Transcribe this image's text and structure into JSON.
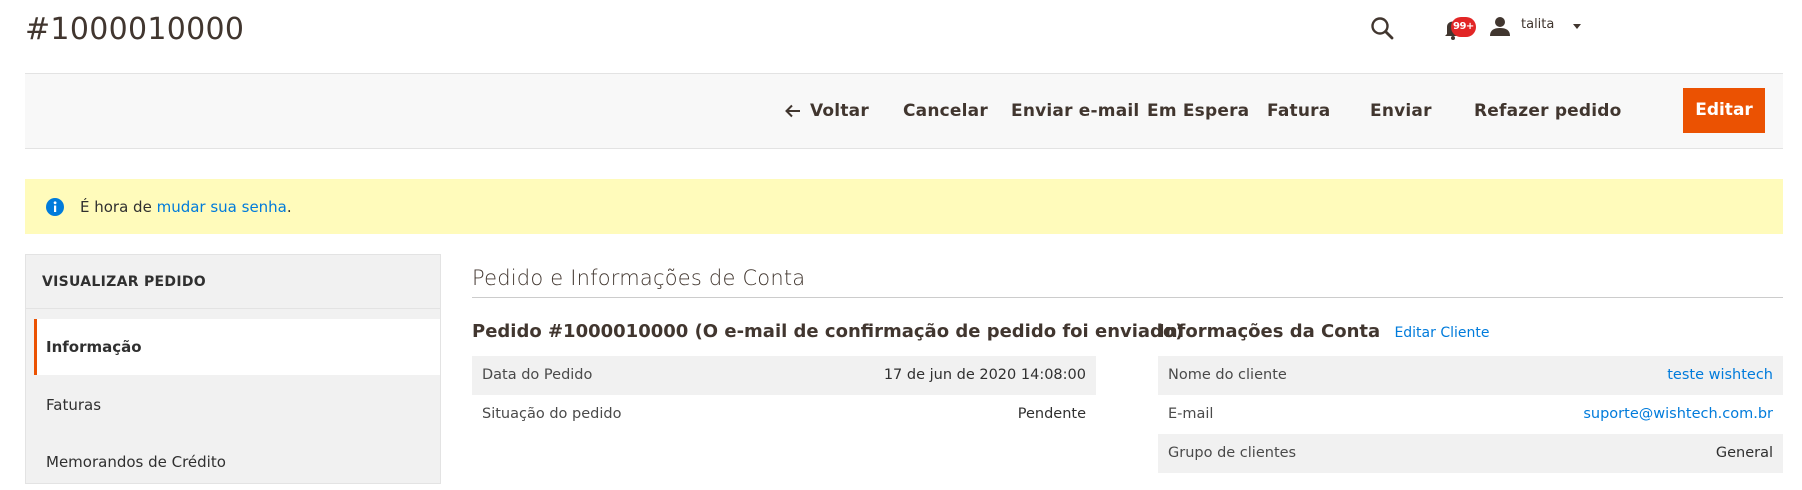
{
  "header": {
    "title": "#1000010000",
    "notifications_badge": "99+",
    "user_name": "talita"
  },
  "actions": {
    "back": "Voltar",
    "cancel": "Cancelar",
    "send_email": "Enviar e-mail",
    "hold": "Em Espera",
    "invoice": "Fatura",
    "ship": "Enviar",
    "reorder": "Refazer pedido",
    "edit": "Editar"
  },
  "notice": {
    "text_before": "É hora de ",
    "link": "mudar sua senha",
    "text_after": "."
  },
  "sidebar": {
    "header": "VISUALIZAR PEDIDO",
    "items": [
      {
        "label": "Informação",
        "active": true
      },
      {
        "label": "Faturas",
        "active": false
      },
      {
        "label": "Memorandos de Crédito",
        "active": false
      }
    ]
  },
  "main": {
    "section_title": "Pedido e Informações de Conta",
    "order": {
      "title": "Pedido #1000010000 (O e-mail de confirmação de pedido foi enviado)",
      "rows": [
        {
          "label": "Data do Pedido",
          "value": "17 de jun de 2020 14:08:00"
        },
        {
          "label": "Situação do pedido",
          "value": "Pendente"
        }
      ]
    },
    "account": {
      "title": "Informações da Conta",
      "edit_link": "Editar Cliente",
      "rows": [
        {
          "label": "Nome do cliente",
          "value": "teste wishtech"
        },
        {
          "label": "E-mail",
          "value": "suporte@wishtech.com.br"
        },
        {
          "label": "Grupo de clientes",
          "value": "General"
        }
      ]
    }
  },
  "colors": {
    "accent": "#eb5202",
    "link": "#007bdb",
    "notice_bg": "#fffbbb",
    "badge": "#e22626"
  },
  "icons": [
    "search-icon",
    "bell-icon",
    "user-icon",
    "caret-down-icon",
    "arrow-left-icon",
    "info-icon"
  ]
}
